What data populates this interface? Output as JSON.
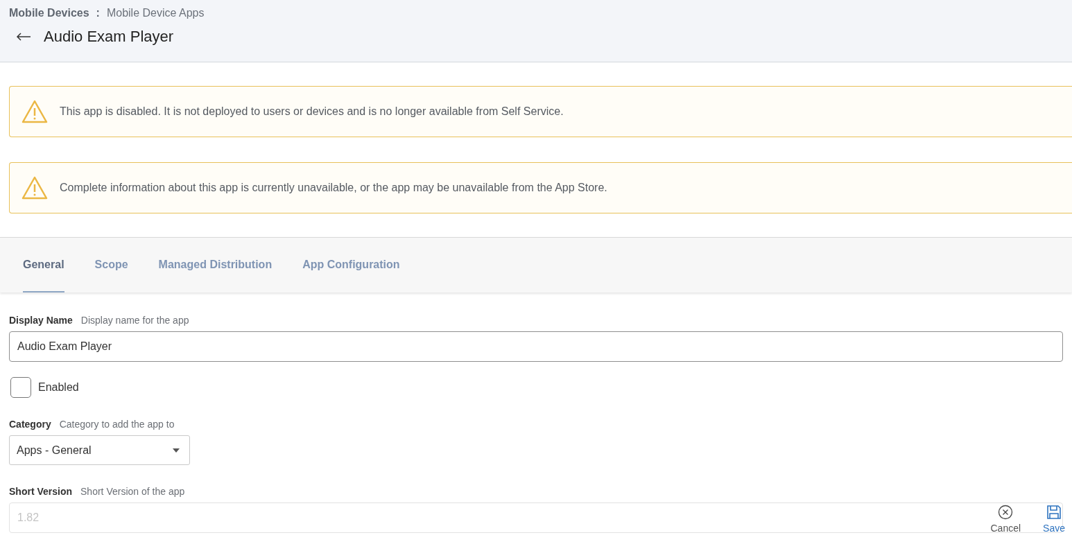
{
  "breadcrumb": {
    "parent": "Mobile Devices",
    "separator": ":",
    "current": "Mobile Device Apps"
  },
  "title": "Audio Exam Player",
  "alerts": [
    {
      "kind": "warning",
      "text": "This app is disabled. It is not deployed to users or devices and is no longer available from Self Service."
    },
    {
      "kind": "warning",
      "text": "Complete information about this app is currently unavailable, or the app may be unavailable from the App Store."
    }
  ],
  "tabs": [
    {
      "label": "General",
      "selected": true
    },
    {
      "label": "Scope",
      "selected": false
    },
    {
      "label": "Managed Distribution",
      "selected": false
    },
    {
      "label": "App Configuration",
      "selected": false
    }
  ],
  "form": [
    {
      "kind": "text",
      "label": "Display Name",
      "hint": "Display name for the app",
      "value": "Audio Exam Player",
      "disabled": false
    },
    {
      "kind": "checkbox",
      "label": "Enabled",
      "checked": false
    },
    {
      "kind": "select",
      "label": "Category",
      "hint": "Category to add the app to",
      "value": "Apps - General"
    },
    {
      "kind": "text",
      "label": "Short Version",
      "hint": "Short Version of the app",
      "value": "1.82",
      "disabled": true
    }
  ],
  "actions": [
    {
      "kind": "cancel",
      "label": "Cancel"
    },
    {
      "kind": "save",
      "label": "Save"
    }
  ]
}
